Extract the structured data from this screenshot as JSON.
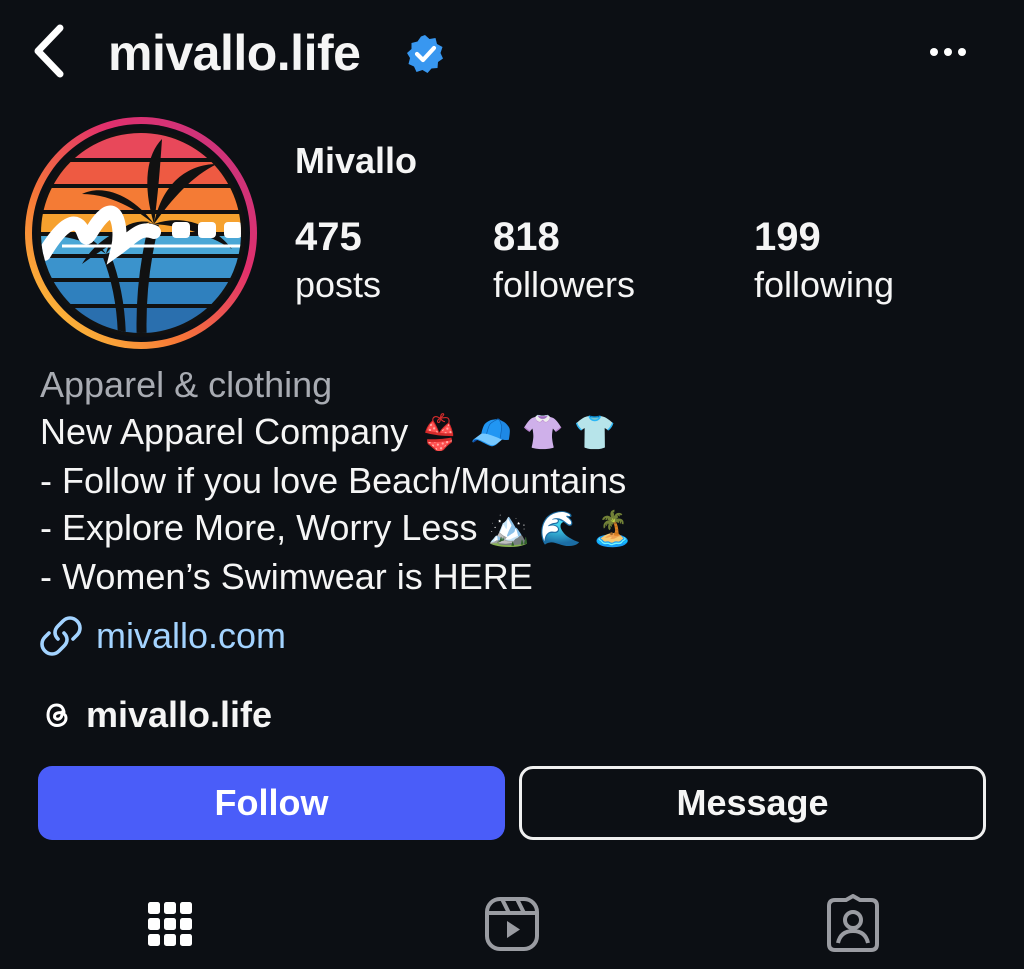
{
  "header": {
    "username": "mivallo.life",
    "back_icon": "chevron-left-icon",
    "verified_icon": "verified-badge-icon",
    "more_icon": "ellipsis-icon"
  },
  "profile": {
    "display_name": "Mivallo",
    "stats": [
      {
        "value": "475",
        "label": "posts"
      },
      {
        "value": "818",
        "label": "followers"
      },
      {
        "value": "199",
        "label": "following"
      }
    ]
  },
  "bio": {
    "category": "Apparel & clothing",
    "lines": [
      "New Apparel Company",
      "- Follow if you love Beach/Mountains",
      "- Explore More, Worry Less",
      "- Women’s Swimwear is HERE"
    ],
    "line1_emojis": "👙 🧢 👚 👕",
    "line3_emojis": "🏔️ 🌊 🏝️"
  },
  "link": {
    "text": "mivallo.com",
    "icon": "link-icon"
  },
  "threads": {
    "handle": "mivallo.life",
    "icon": "threads-icon"
  },
  "actions": {
    "follow_label": "Follow",
    "message_label": "Message"
  },
  "tabs": [
    {
      "name": "posts-grid",
      "icon": "grid-icon"
    },
    {
      "name": "reels",
      "icon": "reels-icon"
    },
    {
      "name": "tagged",
      "icon": "tagged-person-icon"
    }
  ],
  "colors": {
    "background": "#0c0f14",
    "follow_button": "#4a5df9",
    "verified": "#3897f0",
    "link": "#a3d3ff",
    "category": "#a8abb2"
  }
}
